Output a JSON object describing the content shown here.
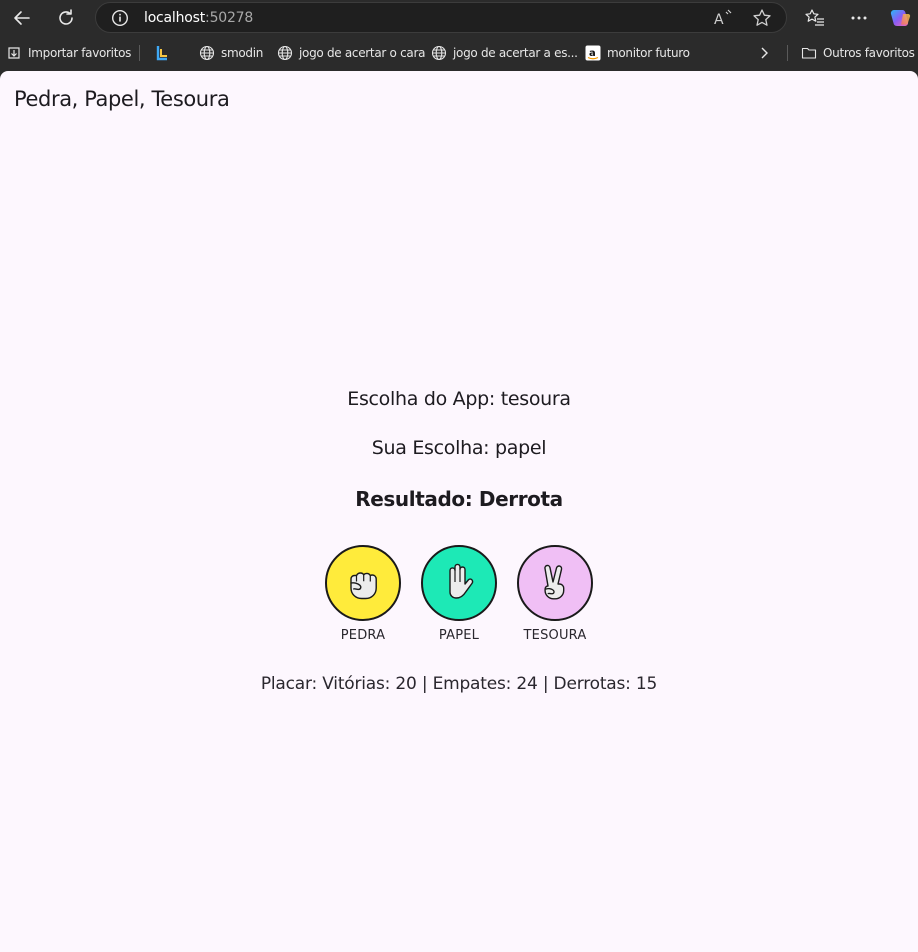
{
  "browser": {
    "url_host": "localhost",
    "url_port": ":50278",
    "bookmarks": [
      {
        "label": "Importar favoritos",
        "icon": "import-icon"
      },
      {
        "label": "",
        "icon": "l-logo-icon"
      },
      {
        "label": "smodin",
        "icon": "globe-icon"
      },
      {
        "label": "jogo de acertar o cara",
        "icon": "globe-icon"
      },
      {
        "label": "jogo de acertar a es...",
        "icon": "globe-icon"
      },
      {
        "label": "monitor futuro",
        "icon": "amazon-icon"
      }
    ],
    "other_bookmarks": "Outros favoritos"
  },
  "app": {
    "title": "Pedra, Papel, Tesoura",
    "app_choice": "Escolha do App: tesoura",
    "user_choice": "Sua Escolha: papel",
    "result": "Resultado: Derrota",
    "choices": [
      {
        "label": "PEDRA",
        "icon": "rock-hand-icon",
        "color": "#ffeb3b"
      },
      {
        "label": "PAPEL",
        "icon": "paper-hand-icon",
        "color": "#1de9b6"
      },
      {
        "label": "TESOURA",
        "icon": "scissors-hand-icon",
        "color": "#f0bff5"
      }
    ],
    "score": "Placar: Vitórias: 20 | Empates: 24 | Derrotas: 15"
  }
}
